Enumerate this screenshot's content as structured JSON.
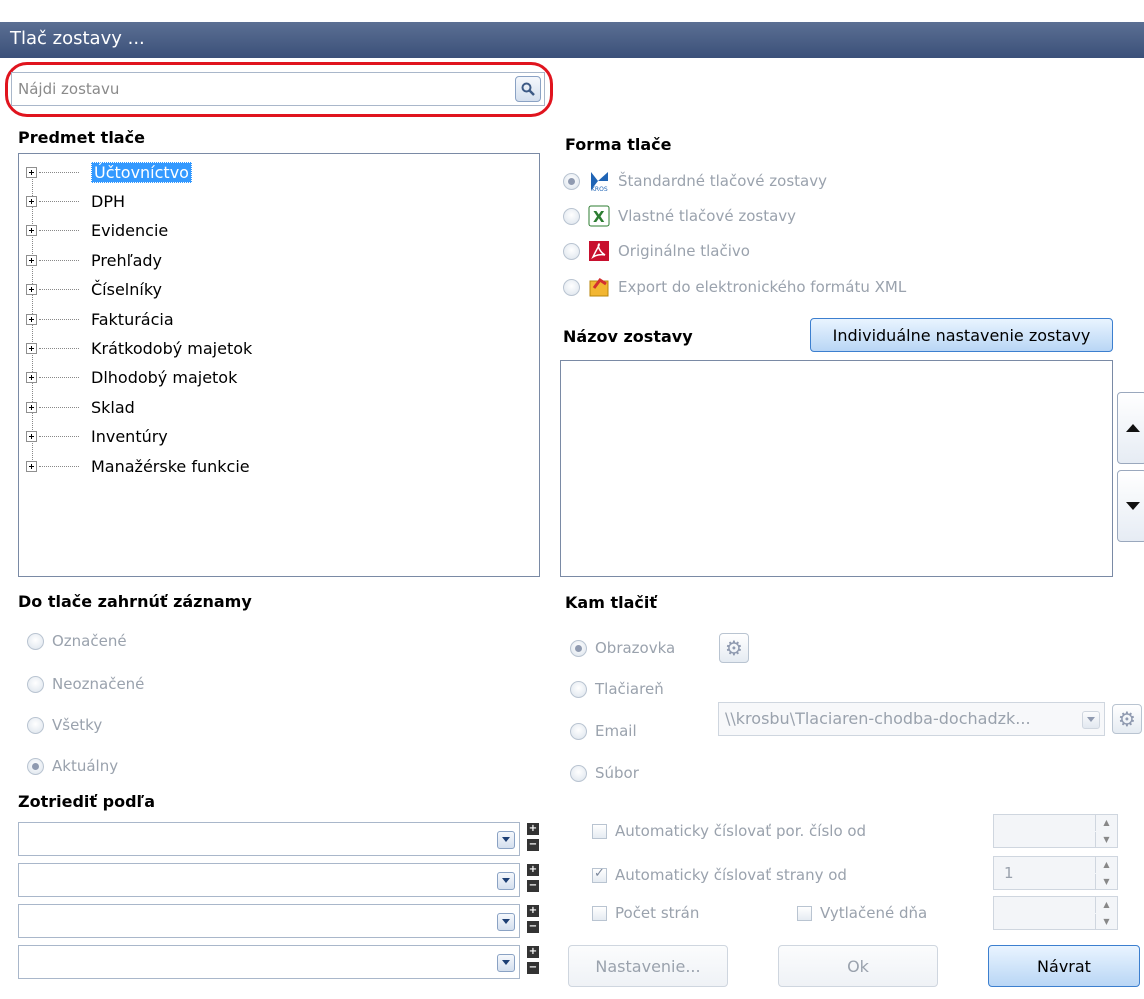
{
  "window": {
    "title": "Tlač zostavy ..."
  },
  "search": {
    "placeholder": "Nájdi zostavu"
  },
  "subject": {
    "heading": "Predmet tlače",
    "items": [
      "Účtovníctvo",
      "DPH",
      "Evidencie",
      "Prehľady",
      "Číselníky",
      "Fakturácia",
      "Krátkodobý majetok",
      "Dlhodobý majetok",
      "Sklad",
      "Inventúry",
      "Manažérske funkcie"
    ]
  },
  "form": {
    "heading": "Forma tlače",
    "options": [
      "Štandardné tlačové zostavy",
      "Vlastné tlačové zostavy",
      "Originálne tlačivo",
      "Export do elektronického formátu XML"
    ],
    "selected_index": 0
  },
  "report_name": {
    "heading": "Názov zostavy",
    "individual_button": "Individuálne nastavenie zostavy"
  },
  "include": {
    "heading": "Do tlače zahrnúť záznamy",
    "options": [
      "Označené",
      "Neoznačené",
      "Všetky",
      "Aktuálny"
    ],
    "selected_index": 3
  },
  "sort": {
    "heading": "Zotriediť podľa",
    "plus": "+",
    "minus": "−"
  },
  "destination": {
    "heading": "Kam tlačiť",
    "options": [
      "Obrazovka",
      "Tlačiareň",
      "Email",
      "Súbor"
    ],
    "selected_index": 0,
    "printer_value": "\\\\krosbu\\Tlaciaren-chodba-dochadzk..."
  },
  "numbering": {
    "auto_number_label": "Automaticky číslovať por. číslo od",
    "auto_number_checked": false,
    "auto_pages_label": "Automaticky číslovať strany od",
    "auto_pages_checked": true,
    "auto_pages_value": "1",
    "page_count_label": "Počet strán",
    "printed_today_label": "Vytlačené dňa"
  },
  "buttons": {
    "settings": "Nastavenie...",
    "ok": "Ok",
    "back": "Návrat"
  },
  "colors": {
    "title_bar": "#4a5f87",
    "highlight": "#e0141e",
    "selection": "#3399ff"
  }
}
